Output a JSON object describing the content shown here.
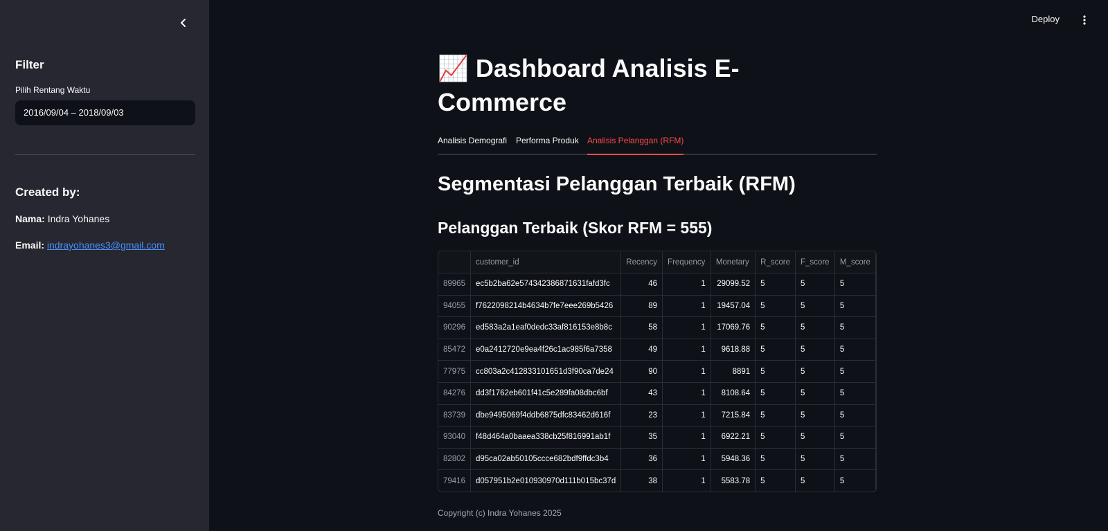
{
  "sidebar": {
    "filter_title": "Filter",
    "date_label": "Pilih Rentang Waktu",
    "date_value": "2016/09/04 – 2018/09/03",
    "created_title": "Created by:",
    "name_label": "Nama:",
    "name_value": "Indra Yohanes",
    "email_label": "Email:",
    "email_value": "indrayohanes3@gmail.com"
  },
  "topbar": {
    "deploy_label": "Deploy"
  },
  "main": {
    "title_emoji": "📈",
    "title": "Dashboard Analisis E-Commerce",
    "tabs": [
      {
        "label": "Analisis Demografi",
        "active": false
      },
      {
        "label": "Performa Produk",
        "active": false
      },
      {
        "label": "Analisis Pelanggan (RFM)",
        "active": true
      }
    ],
    "section_heading": "Segmentasi Pelanggan Terbaik (RFM)",
    "subheading": "Pelanggan Terbaik (Skor RFM = 555)",
    "table": {
      "columns": [
        "",
        "customer_id",
        "Recency",
        "Frequency",
        "Monetary",
        "R_score",
        "F_score",
        "M_score"
      ],
      "rows": [
        [
          "89965",
          "ec5b2ba62e574342386871631fafd3fc",
          "46",
          "1",
          "29099.52",
          "5",
          "5",
          "5"
        ],
        [
          "94055",
          "f7622098214b4634b7fe7eee269b5426",
          "89",
          "1",
          "19457.04",
          "5",
          "5",
          "5"
        ],
        [
          "90296",
          "ed583a2a1eaf0dedc33af816153e8b8c",
          "58",
          "1",
          "17069.76",
          "5",
          "5",
          "5"
        ],
        [
          "85472",
          "e0a2412720e9ea4f26c1ac985f6a7358",
          "49",
          "1",
          "9618.88",
          "5",
          "5",
          "5"
        ],
        [
          "77975",
          "cc803a2c412833101651d3f90ca7de24",
          "90",
          "1",
          "8891",
          "5",
          "5",
          "5"
        ],
        [
          "84276",
          "dd3f1762eb601f41c5e289fa08dbc6bf",
          "43",
          "1",
          "8108.64",
          "5",
          "5",
          "5"
        ],
        [
          "83739",
          "dbe9495069f4ddb6875dfc83462d616f",
          "23",
          "1",
          "7215.84",
          "5",
          "5",
          "5"
        ],
        [
          "93040",
          "f48d464a0baaea338cb25f816991ab1f",
          "35",
          "1",
          "6922.21",
          "5",
          "5",
          "5"
        ],
        [
          "82802",
          "d95ca02ab50105ccce682bdf9ffdc3b4",
          "36",
          "1",
          "5948.36",
          "5",
          "5",
          "5"
        ],
        [
          "79416",
          "d057951b2e010930970d111b015bc37d",
          "38",
          "1",
          "5583.78",
          "5",
          "5",
          "5"
        ]
      ]
    },
    "copyright": "Copyright (c) Indra Yohanes 2025"
  },
  "colors": {
    "accent": "#ff4b4b",
    "sidebar_bg": "#262730",
    "main_bg": "#0e1117",
    "link": "#4a90ff"
  }
}
